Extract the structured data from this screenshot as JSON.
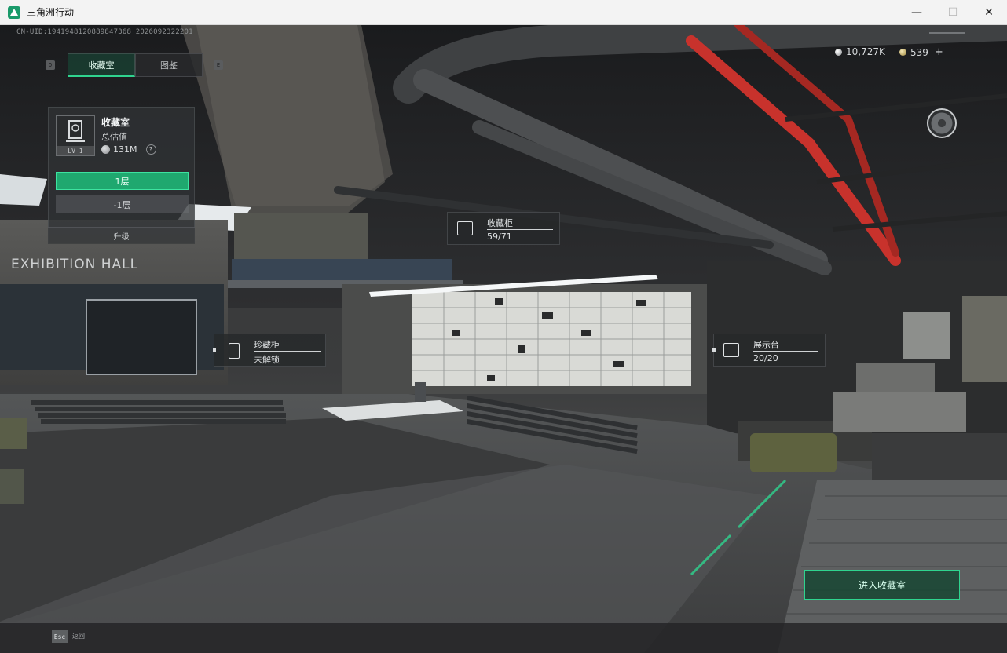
{
  "window": {
    "title": "三角洲行动",
    "controls": {
      "minimize": "—",
      "maximize": "☐",
      "close": "✕"
    }
  },
  "hud": {
    "uid": "CN-UID:1941948120889847368_2026092322201",
    "tab_prev_key": "Q",
    "tab_next_key": "E",
    "tabs": [
      {
        "label": "收藏室",
        "active": true
      },
      {
        "label": "图鉴",
        "active": false
      }
    ],
    "collection": {
      "badge_level": "LV 1",
      "title": "收藏室",
      "subtitle": "总估值",
      "value": "131M",
      "help": "?",
      "floors": [
        {
          "label": "1层",
          "selected": true
        },
        {
          "label": "-1层",
          "selected": false
        }
      ],
      "upgrade": "升级"
    },
    "currency": {
      "silver": "10,727K",
      "gold": "539",
      "add": "+"
    },
    "markers": {
      "cabinet": {
        "title": "收藏柜",
        "value": "59/71"
      },
      "treasure": {
        "title": "珍藏柜",
        "value": "未解锁"
      },
      "display": {
        "title": "展示台",
        "value": "20/20"
      }
    },
    "enter_button": "进入收藏室",
    "esc": {
      "key": "Esc",
      "label": "返回"
    }
  },
  "scene": {
    "wall_sign": "EXHIBITION HALL",
    "accent_green": "#2fd48f",
    "pipe_red": "#c8322c"
  }
}
